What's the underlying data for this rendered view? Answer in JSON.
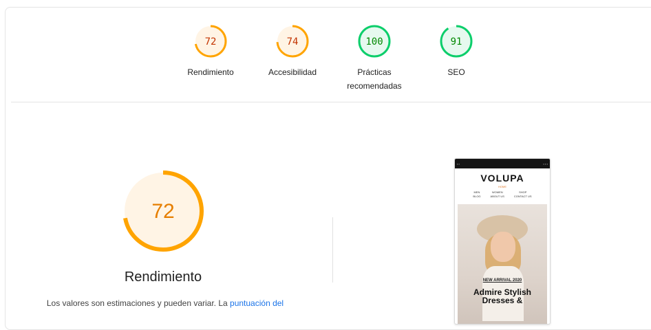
{
  "gauges": [
    {
      "score": "72",
      "label": "Rendimiento",
      "color": "#ffa400",
      "text_color": "#c33300",
      "fraction": 0.72
    },
    {
      "score": "74",
      "label": "Accesibilidad",
      "color": "#ffa400",
      "text_color": "#c33300",
      "fraction": 0.74
    },
    {
      "score": "100",
      "label": "Prácticas recomendadas",
      "color": "#0cce6b",
      "text_color": "#008800",
      "fraction": 1.0
    },
    {
      "score": "91",
      "label": "SEO",
      "color": "#0cce6b",
      "text_color": "#008800",
      "fraction": 0.91
    }
  ],
  "performance": {
    "score": "72",
    "fraction": 0.72,
    "title": "Rendimiento",
    "desc_prefix": "Los valores son estimaciones y pueden variar. La ",
    "desc_link": "puntuación del"
  },
  "preview": {
    "brand": "VOLUPA",
    "home": "HOME",
    "nav_col1": [
      "MEN",
      "BLOG"
    ],
    "nav_col2": [
      "WOMEN",
      "ABOUT US"
    ],
    "nav_col3": [
      "SHOP",
      "CONTACT US"
    ],
    "arrival": "NEW ARRIVAL 2020",
    "headline": "Admire Stylish Dresses &"
  },
  "colors": {
    "average": "#ffa400",
    "pass": "#0cce6b",
    "link": "#1a73e8"
  }
}
